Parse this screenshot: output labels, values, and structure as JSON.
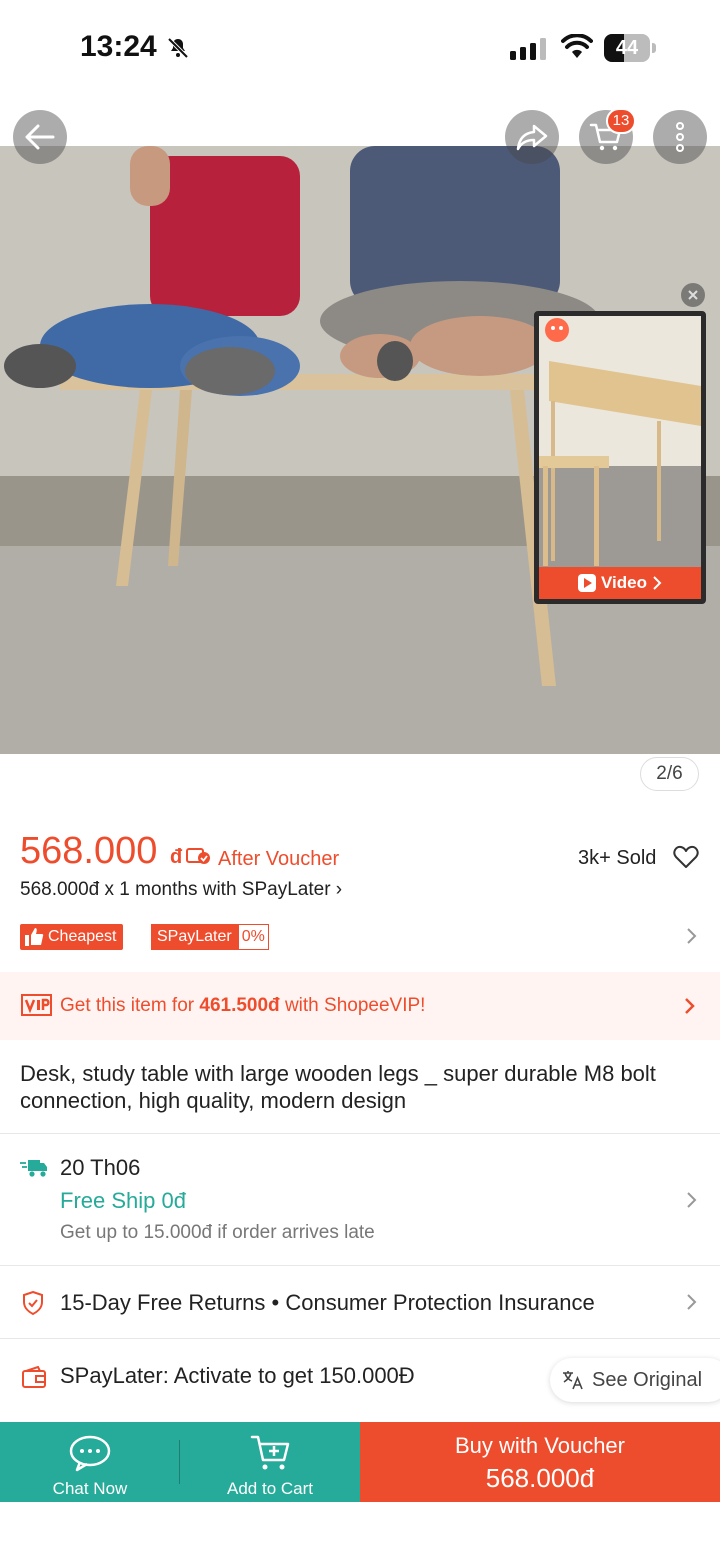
{
  "status_bar": {
    "time": "13:24",
    "battery": "44"
  },
  "top_nav": {
    "cart_badge": "13"
  },
  "gallery": {
    "pager": "2/6",
    "video_label": "Video"
  },
  "price": {
    "amount": "568.000",
    "currency": "đ",
    "after_voucher": "After Voucher",
    "sold": "3k+ Sold",
    "installment": "568.000đ x 1 months with SPayLater ›"
  },
  "tags": {
    "cheapest": "Cheapest",
    "spaylater": "SPayLater",
    "spaylater_rate": "0%"
  },
  "vip": {
    "logo": "VIP",
    "prefix": "Get this item for ",
    "amount": "461.500đ",
    "suffix": " with ShopeeVIP!"
  },
  "product": {
    "title": "Desk, study table with large wooden legs _ super durable M8 bolt connection, high quality, modern design"
  },
  "shipping": {
    "date": "20 Th06",
    "free_ship": "Free Ship 0đ",
    "late_note": "Get up to 15.000đ if order arrives late"
  },
  "guarantee": {
    "text": "15-Day Free Returns  •  Consumer Protection Insurance"
  },
  "spaylater_promo": {
    "text": "SPayLater: Activate to get 150.000Đ",
    "see_original": "See Original"
  },
  "bottom_bar": {
    "chat": "Chat Now",
    "add_to_cart": "Add to Cart",
    "buy": "Buy with Voucher",
    "buy_price": "568.000đ"
  },
  "colors": {
    "accent": "#ee4d2d",
    "teal": "#26aa99"
  },
  "icons": [
    "bell-off-icon",
    "signal-icon",
    "wifi-icon",
    "battery-icon",
    "back-arrow-icon",
    "share-icon",
    "cart-icon",
    "more-icon",
    "voucher-icon",
    "heart-icon",
    "thumb-icon",
    "chevron-right-icon",
    "vip-icon",
    "truck-icon",
    "shield-icon",
    "wallet-icon",
    "translate-icon",
    "chat-icon",
    "cart-plus-icon"
  ]
}
